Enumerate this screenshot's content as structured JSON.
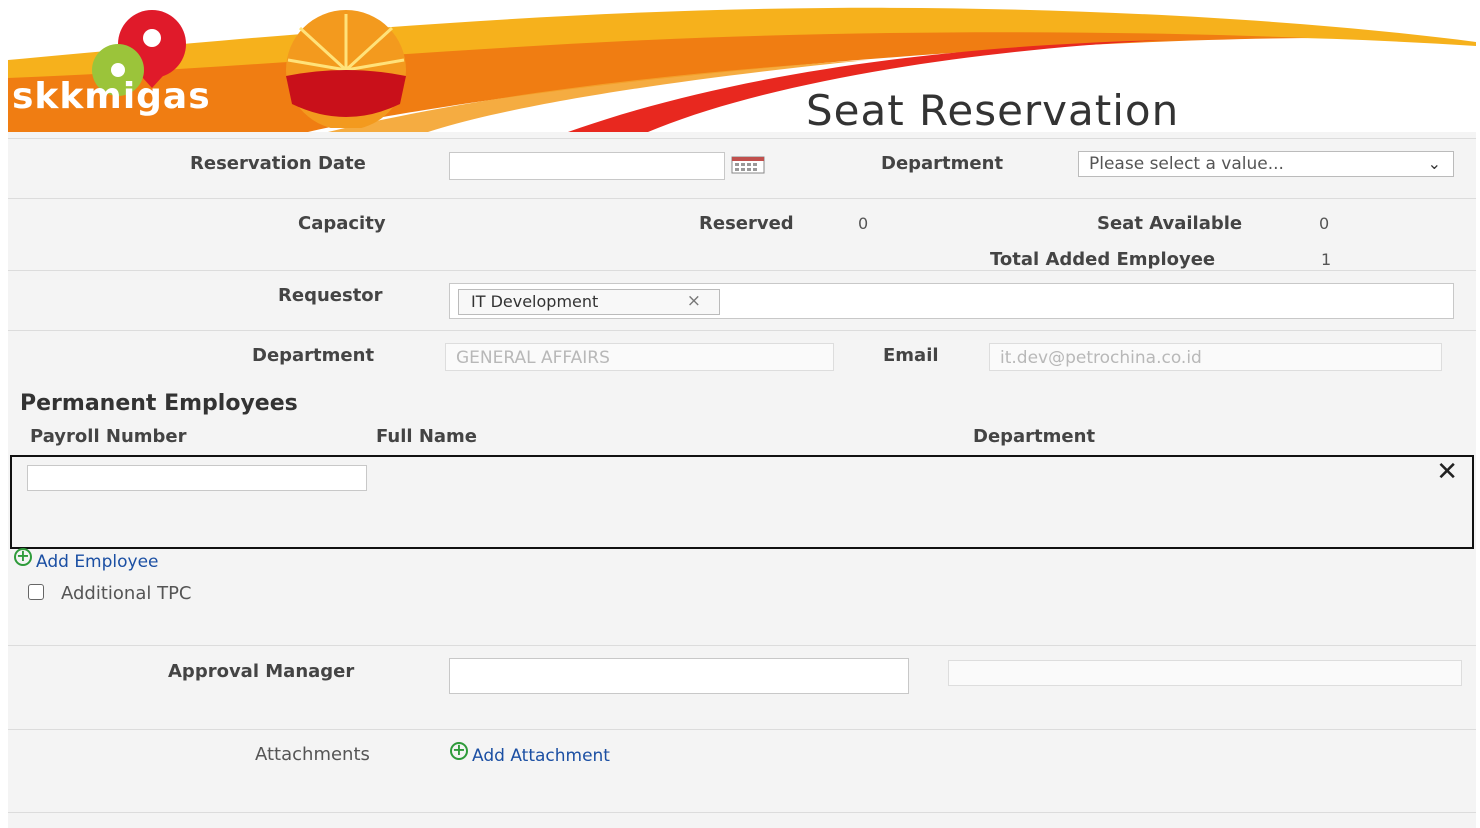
{
  "header": {
    "brand": "skkmigas",
    "title": "Seat Reservation"
  },
  "reservation": {
    "date_label": "Reservation Date",
    "date_value": "",
    "department_label": "Department",
    "department_placeholder": "Please select a value..."
  },
  "stats": {
    "capacity_label": "Capacity",
    "reserved_label": "Reserved",
    "reserved_value": "0",
    "seat_available_label": "Seat Available",
    "seat_available_value": "0",
    "total_added_label": "Total Added Employee",
    "total_added_value": "1"
  },
  "requestor": {
    "label": "Requestor",
    "tag": "IT Development",
    "tag_remove": "×"
  },
  "requestor_info": {
    "department_label": "Department",
    "department_value": "GENERAL AFFAIRS",
    "email_label": "Email",
    "email_value": "it.dev@petrochina.co.id"
  },
  "employees": {
    "section_title": "Permanent Employees",
    "columns": [
      "Payroll Number",
      "Full Name",
      "Department"
    ],
    "remove_icon": "✕",
    "add_label": "Add Employee",
    "additional_tpc_label": "Additional TPC"
  },
  "approval": {
    "label": "Approval Manager"
  },
  "attachments": {
    "label": "Attachments",
    "add_label": "Add Attachment"
  },
  "colors": {
    "brand_orange": "#f39a1e",
    "brand_red": "#d4121d",
    "link_blue": "#1b4fa3",
    "plus_green": "#2e9b3a"
  }
}
